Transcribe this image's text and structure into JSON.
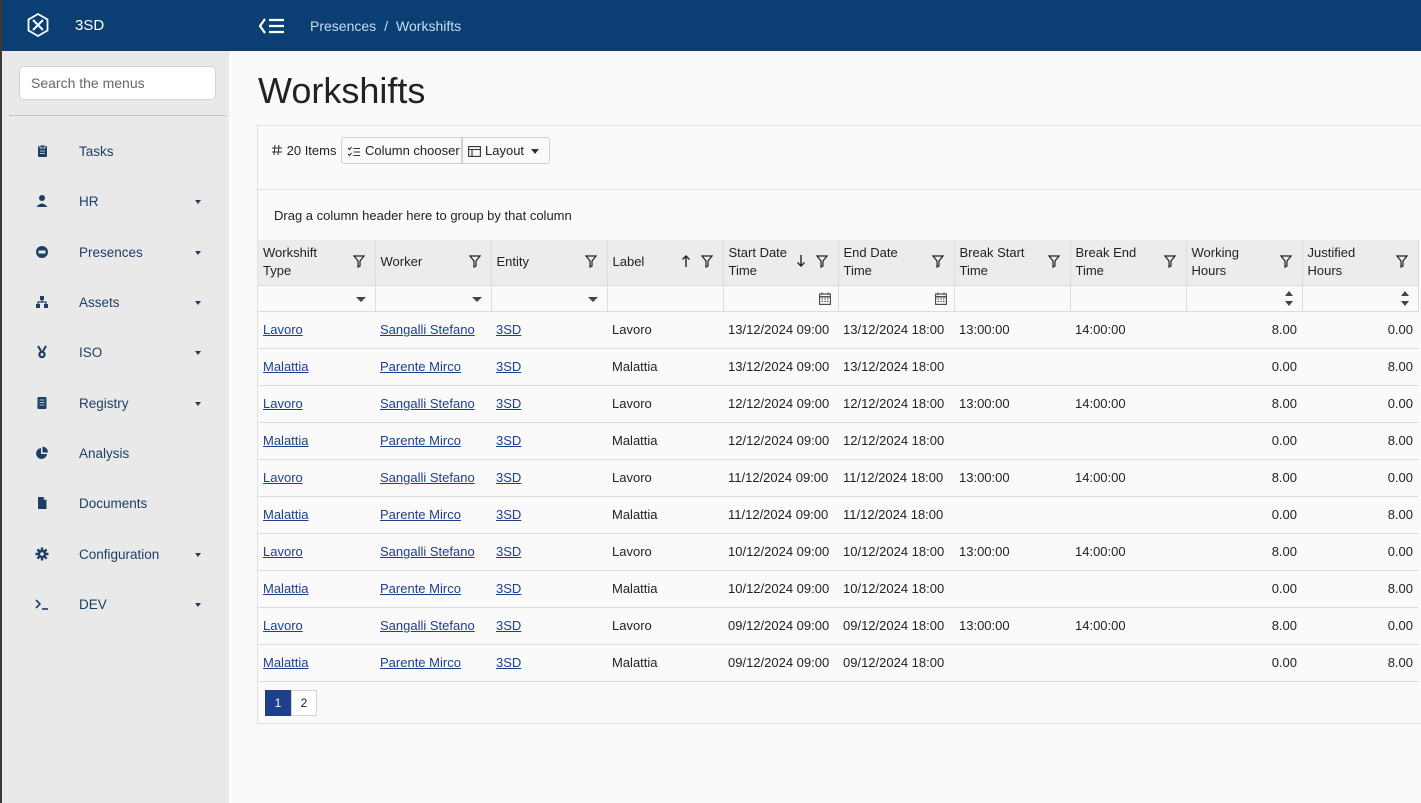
{
  "app": {
    "name": "3SD"
  },
  "breadcrumb": {
    "parent": "Presences",
    "separator": "/",
    "current": "Workshifts"
  },
  "sidebar": {
    "search_placeholder": "Search the menus",
    "items": [
      {
        "label": "Tasks",
        "icon": "clipboard-icon",
        "has_submenu": false
      },
      {
        "label": "HR",
        "icon": "user-icon",
        "has_submenu": true
      },
      {
        "label": "Presences",
        "icon": "calendar-icon",
        "has_submenu": true
      },
      {
        "label": "Assets",
        "icon": "sitemap-icon",
        "has_submenu": true
      },
      {
        "label": "ISO",
        "icon": "medal-icon",
        "has_submenu": true
      },
      {
        "label": "Registry",
        "icon": "book-icon",
        "has_submenu": true
      },
      {
        "label": "Analysis",
        "icon": "pie-chart-icon",
        "has_submenu": false
      },
      {
        "label": "Documents",
        "icon": "file-icon",
        "has_submenu": false
      },
      {
        "label": "Configuration",
        "icon": "gear-icon",
        "has_submenu": true
      },
      {
        "label": "DEV",
        "icon": "terminal-icon",
        "has_submenu": true
      }
    ]
  },
  "page": {
    "title": "Workshifts"
  },
  "toolbar": {
    "item_count": "20 Items",
    "column_chooser": "Column chooser",
    "layout": "Layout"
  },
  "grid": {
    "group_hint": "Drag a column header here to group by that column",
    "columns": [
      {
        "line1": "Workshift",
        "line2": "Type",
        "filter": "dropdown"
      },
      {
        "line1": "Worker",
        "line2": "",
        "filter": "dropdown"
      },
      {
        "line1": "Entity",
        "line2": "",
        "filter": "dropdown"
      },
      {
        "line1": "Label",
        "line2": "",
        "filter": "text",
        "sort": "asc"
      },
      {
        "line1": "Start Date",
        "line2": "Time",
        "filter": "date",
        "sort": "desc"
      },
      {
        "line1": "End Date",
        "line2": "Time",
        "filter": "date"
      },
      {
        "line1": "Break Start",
        "line2": "Time",
        "filter": "text"
      },
      {
        "line1": "Break End",
        "line2": "Time",
        "filter": "text"
      },
      {
        "line1": "Working",
        "line2": "Hours",
        "filter": "number"
      },
      {
        "line1": "Justified",
        "line2": "Hours",
        "filter": "number"
      }
    ],
    "rows": [
      [
        "Lavoro",
        "Sangalli Stefano",
        "3SD",
        "Lavoro",
        "13/12/2024 09:00",
        "13/12/2024 18:00",
        "13:00:00",
        "14:00:00",
        "8.00",
        "0.00"
      ],
      [
        "Malattia",
        "Parente Mirco",
        "3SD",
        "Malattia",
        "13/12/2024 09:00",
        "13/12/2024 18:00",
        "",
        "",
        "0.00",
        "8.00"
      ],
      [
        "Lavoro",
        "Sangalli Stefano",
        "3SD",
        "Lavoro",
        "12/12/2024 09:00",
        "12/12/2024 18:00",
        "13:00:00",
        "14:00:00",
        "8.00",
        "0.00"
      ],
      [
        "Malattia",
        "Parente Mirco",
        "3SD",
        "Malattia",
        "12/12/2024 09:00",
        "12/12/2024 18:00",
        "",
        "",
        "0.00",
        "8.00"
      ],
      [
        "Lavoro",
        "Sangalli Stefano",
        "3SD",
        "Lavoro",
        "11/12/2024 09:00",
        "11/12/2024 18:00",
        "13:00:00",
        "14:00:00",
        "8.00",
        "0.00"
      ],
      [
        "Malattia",
        "Parente Mirco",
        "3SD",
        "Malattia",
        "11/12/2024 09:00",
        "11/12/2024 18:00",
        "",
        "",
        "0.00",
        "8.00"
      ],
      [
        "Lavoro",
        "Sangalli Stefano",
        "3SD",
        "Lavoro",
        "10/12/2024 09:00",
        "10/12/2024 18:00",
        "13:00:00",
        "14:00:00",
        "8.00",
        "0.00"
      ],
      [
        "Malattia",
        "Parente Mirco",
        "3SD",
        "Malattia",
        "10/12/2024 09:00",
        "10/12/2024 18:00",
        "",
        "",
        "0.00",
        "8.00"
      ],
      [
        "Lavoro",
        "Sangalli Stefano",
        "3SD",
        "Lavoro",
        "09/12/2024 09:00",
        "09/12/2024 18:00",
        "13:00:00",
        "14:00:00",
        "8.00",
        "0.00"
      ],
      [
        "Malattia",
        "Parente Mirco",
        "3SD",
        "Malattia",
        "09/12/2024 09:00",
        "09/12/2024 18:00",
        "",
        "",
        "0.00",
        "8.00"
      ]
    ]
  },
  "pager": {
    "pages": [
      "1",
      "2"
    ],
    "current": "1"
  },
  "colors": {
    "topbar": "#0b3f73",
    "sidebar": "#e9e9e9",
    "link": "#1d3f8c",
    "active_page": "#1d3f8c"
  }
}
